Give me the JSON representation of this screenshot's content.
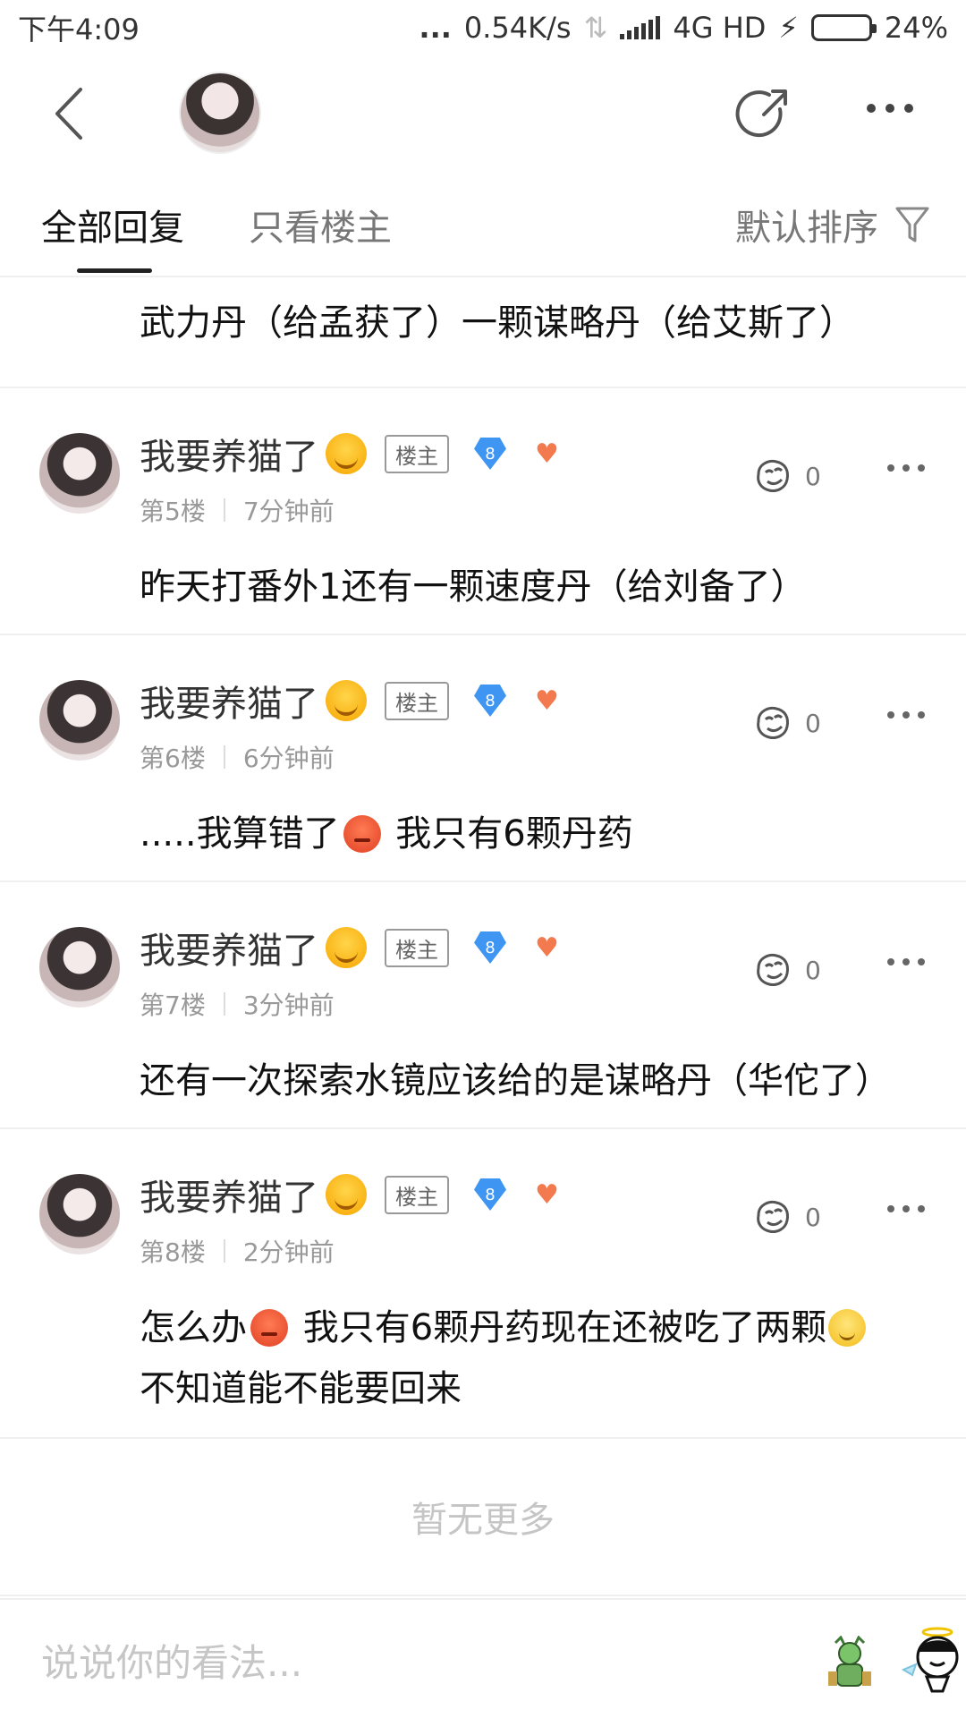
{
  "status_bar": {
    "time": "下午4:09",
    "dots": "...",
    "speed": "0.54K/s",
    "network": "4G HD",
    "battery": "24%",
    "battery_level": 0.24
  },
  "tabs": {
    "all_replies": "全部回复",
    "only_op": "只看楼主",
    "sort": "默认排序"
  },
  "partial_post": {
    "text": "武力丹（给孟获了）一颗谋略丹（给艾斯了）"
  },
  "posts": [
    {
      "username": "我要养猫了",
      "owner_badge": "楼主",
      "level": "8",
      "floor": "第5楼",
      "time": "7分钟前",
      "likes": "0",
      "text_parts": [
        "昨天打番外1还有一颗速度丹（给刘备了）"
      ]
    },
    {
      "username": "我要养猫了",
      "owner_badge": "楼主",
      "level": "8",
      "floor": "第6楼",
      "time": "6分钟前",
      "likes": "0",
      "text_parts": [
        ".....我算错了",
        " 我只有6颗丹药"
      ]
    },
    {
      "username": "我要养猫了",
      "owner_badge": "楼主",
      "level": "8",
      "floor": "第7楼",
      "time": "3分钟前",
      "likes": "0",
      "text_parts": [
        "还有一次探索水镜应该给的是谋略丹（华佗了）"
      ]
    },
    {
      "username": "我要养猫了",
      "owner_badge": "楼主",
      "level": "8",
      "floor": "第8楼",
      "time": "2分钟前",
      "likes": "0",
      "text_parts": [
        "怎么办",
        " 我只有6颗丹药现在还被吃了两颗",
        "不知道能不能要回来"
      ]
    }
  ],
  "no_more": "暂无更多",
  "reply_box": {
    "placeholder": "说说你的看法..."
  },
  "colors": {
    "accent_blue": "#3f95f2",
    "battery_green": "#28c23a",
    "muted_text": "#999999"
  }
}
